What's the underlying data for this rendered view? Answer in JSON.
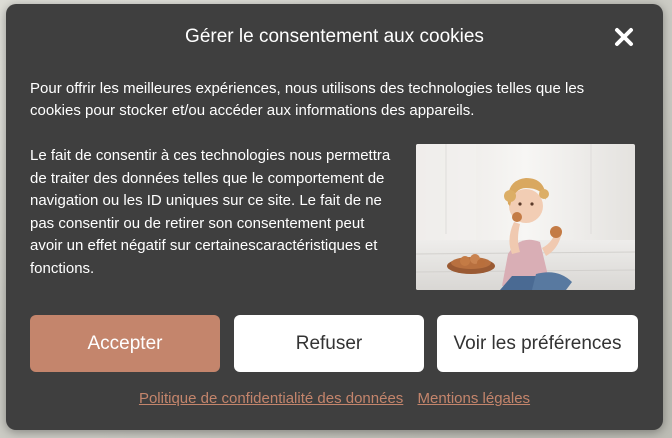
{
  "dialog": {
    "title": "Gérer le consentement aux cookies",
    "intro": "Pour offrir les meilleures expériences, nous utilisons des technologies telles que les cookies pour stocker et/ou accéder aux informations des appareils.",
    "body": "Le fait de consentir à ces technologies nous permettra de traiter des données telles que le comportement de navigation ou les ID uniques sur ce site. Le fait de ne pas consentir ou de retirer son consentement peut avoir un effet négatif sur certainescaractéristiques et fonctions.",
    "close_icon": "close-icon",
    "image": "child-eating-cookies-photo"
  },
  "buttons": {
    "accept": "Accepter",
    "refuse": "Refuser",
    "preferences": "Voir les préférences"
  },
  "links": {
    "privacy": "Politique de confidentialité des données",
    "legal": "Mentions légales"
  },
  "colors": {
    "modal_bg": "#3f3f3f",
    "accent": "#c4856c",
    "text": "#ffffff"
  }
}
